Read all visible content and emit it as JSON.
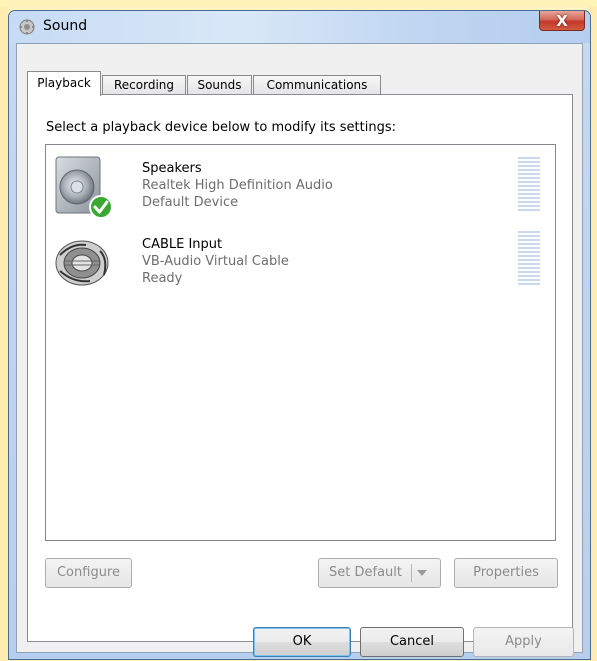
{
  "window": {
    "title": "Sound",
    "close_label": "X"
  },
  "tabs": [
    {
      "label": "Playback",
      "active": true
    },
    {
      "label": "Recording",
      "active": false
    },
    {
      "label": "Sounds",
      "active": false
    },
    {
      "label": "Communications",
      "active": false
    }
  ],
  "instruction": "Select a playback device below to modify its settings:",
  "devices": [
    {
      "name": "Speakers",
      "description": "Realtek High Definition Audio",
      "status": "Default Device",
      "icon": "speaker-icon",
      "is_default": true
    },
    {
      "name": "CABLE Input",
      "description": "VB-Audio Virtual Cable",
      "status": "Ready",
      "icon": "cable-icon",
      "is_default": false
    }
  ],
  "panel_buttons": {
    "configure": "Configure",
    "set_default": "Set Default",
    "properties": "Properties"
  },
  "dialog_buttons": {
    "ok": "OK",
    "cancel": "Cancel",
    "apply": "Apply"
  },
  "colors": {
    "accent": "#3c7fb1",
    "check_green": "#3aa832",
    "disabled_text": "#8b8b8b"
  }
}
